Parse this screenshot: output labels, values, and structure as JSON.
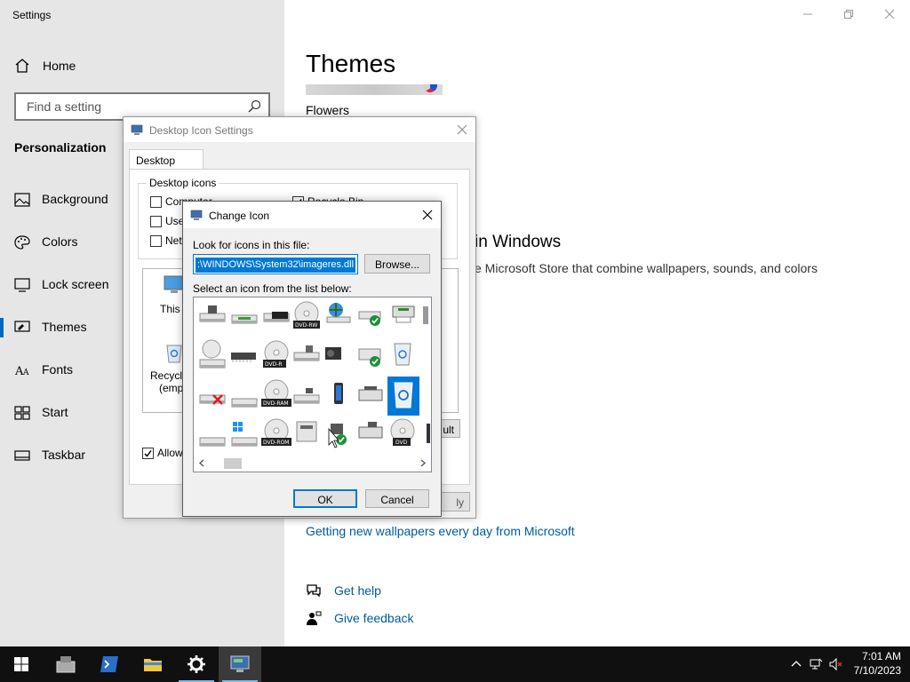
{
  "settings": {
    "app_title": "Settings",
    "home_label": "Home",
    "search_placeholder": "Find a setting",
    "section_title": "Personalization",
    "nav": [
      {
        "label": "Background",
        "icon": "image-icon"
      },
      {
        "label": "Colors",
        "icon": "palette-icon"
      },
      {
        "label": "Lock screen",
        "icon": "monitor-lock-icon"
      },
      {
        "label": "Themes",
        "icon": "brush-icon"
      },
      {
        "label": "Fonts",
        "icon": "font-icon"
      },
      {
        "label": "Start",
        "icon": "start-grid-icon"
      },
      {
        "label": "Taskbar",
        "icon": "taskbar-icon"
      }
    ],
    "active_nav": "Themes",
    "main": {
      "title": "Themes",
      "theme_name": "Flowers",
      "store_heading": "in Windows",
      "store_desc": "e Microsoft Store that combine wallpapers, sounds, and colors",
      "wallpaper_link": "Getting new wallpapers every day from Microsoft",
      "get_help": "Get help",
      "give_feedback": "Give feedback"
    }
  },
  "desktop_icon_settings": {
    "title": "Desktop Icon Settings",
    "tab": "Desktop Icons",
    "group_label": "Desktop icons",
    "checkboxes": [
      {
        "label": "Computer",
        "checked": false
      },
      {
        "label": "User",
        "checked": false
      },
      {
        "label": "Netw",
        "checked": false
      },
      {
        "label": "Recycle Bin",
        "checked": true
      }
    ],
    "icon_items": [
      "This P",
      "Recycle",
      "(empt"
    ],
    "allow_label": "Allow t",
    "restore_btn": "ult",
    "apply_btn": "ly"
  },
  "change_icon": {
    "title": "Change Icon",
    "look_label": "Look for icons in this file:",
    "path_value": ":\\WINDOWS\\System32\\imageres.dll",
    "browse": "Browse...",
    "select_label": "Select an icon from the list below:",
    "icon_badges": [
      "DVD-RW",
      "DVD-R",
      "DVD-RAM",
      "DVD-ROM",
      "DVD"
    ],
    "ok": "OK",
    "cancel": "Cancel"
  },
  "taskbar": {
    "time": "7:01 AM",
    "date": "7/10/2023",
    "apps": [
      "start-icon",
      "server-manager-icon",
      "powershell-icon",
      "file-explorer-icon",
      "settings-gear-icon",
      "control-panel-icon"
    ]
  },
  "colors": {
    "accent": "#0078d7",
    "link": "#005a9e",
    "taskbar": "#101010",
    "sidebar": "#e6e6e6"
  }
}
